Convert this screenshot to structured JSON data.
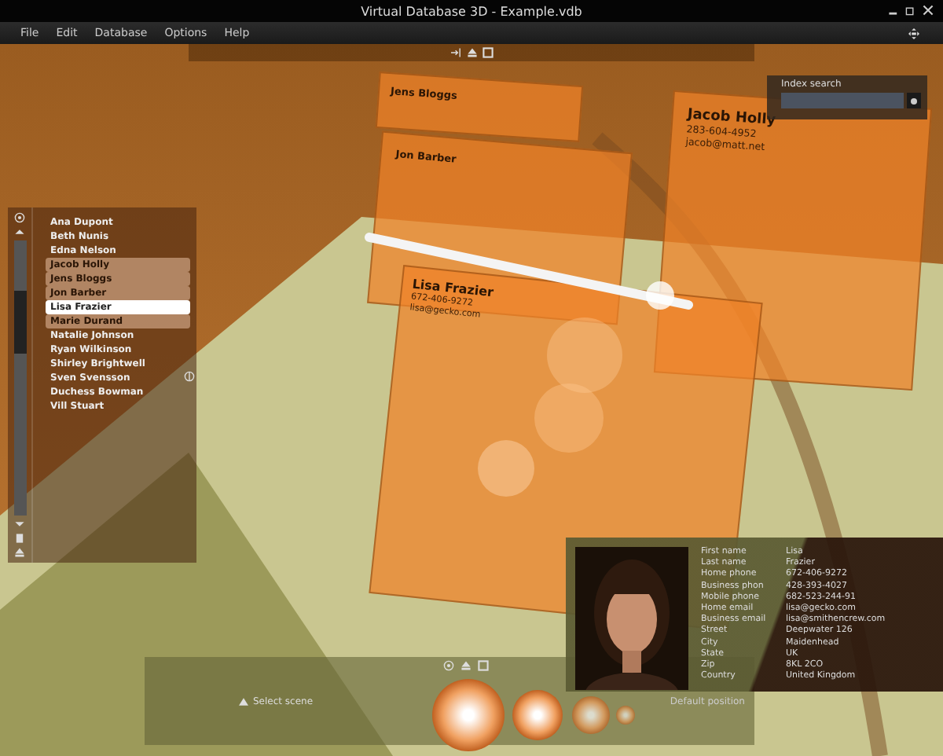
{
  "window": {
    "title": "Virtual Database 3D - Example.vdb"
  },
  "menu": [
    "File",
    "Edit",
    "Database",
    "Options",
    "Help"
  ],
  "cards": [
    {
      "name": "Jens Bloggs"
    },
    {
      "name": "Jon Barber"
    },
    {
      "name": "Jacob Holly",
      "lines": [
        "283-604-4952",
        "jacob@matt.net"
      ]
    },
    {
      "name": "Lisa Frazier",
      "lines": [
        "672-406-9272",
        "lisa@gecko.com"
      ]
    }
  ],
  "index_search": {
    "label": "Index search"
  },
  "contacts": [
    {
      "name": "Ana Dupont",
      "highlighted": false,
      "selected": false
    },
    {
      "name": "Beth Nunis",
      "highlighted": false,
      "selected": false
    },
    {
      "name": "Edna Nelson",
      "highlighted": false,
      "selected": false
    },
    {
      "name": "Jacob Holly",
      "highlighted": true,
      "selected": false
    },
    {
      "name": "Jens Bloggs",
      "highlighted": true,
      "selected": false
    },
    {
      "name": "Jon Barber",
      "highlighted": true,
      "selected": false
    },
    {
      "name": "Lisa Frazier",
      "highlighted": true,
      "selected": true
    },
    {
      "name": "Marie Durand",
      "highlighted": true,
      "selected": false
    },
    {
      "name": "Natalie Johnson",
      "highlighted": false,
      "selected": false
    },
    {
      "name": "Ryan Wilkinson",
      "highlighted": false,
      "selected": false
    },
    {
      "name": "Shirley Brightwell",
      "highlighted": false,
      "selected": false
    },
    {
      "name": "Sven Svensson",
      "highlighted": false,
      "selected": false
    },
    {
      "name": "Duchess Bowman",
      "highlighted": false,
      "selected": false
    },
    {
      "name": "Vill Stuart",
      "highlighted": false,
      "selected": false
    }
  ],
  "details": [
    {
      "label": "First name",
      "value": "Lisa"
    },
    {
      "label": "Last name",
      "value": "Frazier"
    },
    {
      "label": "Home phone",
      "value": "672-406-9272"
    },
    {
      "label": "Business phon",
      "value": "428-393-4027"
    },
    {
      "label": "Mobile phone",
      "value": "682-523-244-91"
    },
    {
      "label": "Home email",
      "value": "lisa@gecko.com"
    },
    {
      "label": "Business email",
      "value": "lisa@smithencrew.com"
    },
    {
      "label": "Street",
      "value": "Deepwater 126"
    },
    {
      "label": "City",
      "value": "Maidenhead"
    },
    {
      "label": "State",
      "value": "UK"
    },
    {
      "label": "Zip",
      "value": "8KL 2CO"
    },
    {
      "label": "Country",
      "value": "United Kingdom"
    }
  ],
  "bottom_bar": {
    "select_scene": "Select scene",
    "default_position": "Default position"
  }
}
